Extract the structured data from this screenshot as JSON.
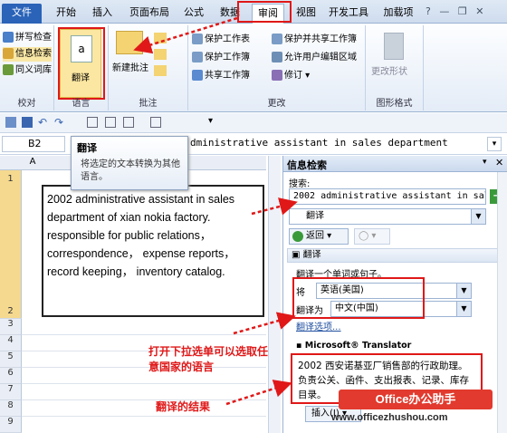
{
  "tabs": {
    "file": "文件",
    "items": [
      "开始",
      "插入",
      "页面布局",
      "公式",
      "数据",
      "审阅",
      "视图",
      "开发工具",
      "加载项"
    ]
  },
  "title_controls": {
    "help": "?",
    "minimize": "—",
    "restore": "❐",
    "close": "✕"
  },
  "ribbon": {
    "proof": {
      "label": "校对",
      "items": [
        "拼写检查",
        "信息检索",
        "同义词库"
      ]
    },
    "language": {
      "label": "语言",
      "translate": "翻译"
    },
    "comments": {
      "label": "批注",
      "new_comment": "新建批注"
    },
    "changes": {
      "label": "更改",
      "items": [
        "保护工作表",
        "保护工作簿",
        "共享工作簿"
      ],
      "items2": [
        "保护并共享工作簿",
        "允许用户编辑区域",
        "修订 ▾"
      ]
    },
    "ink": {
      "label": "图形格式",
      "item": "更改形状"
    }
  },
  "tooltip": {
    "title": "翻译",
    "body": "将选定的文本转换为其他语言。"
  },
  "formula_bar": {
    "cell_ref": "B2",
    "value": "dministrative assistant in sales department"
  },
  "grid": {
    "col_a": "A",
    "rows": [
      "1",
      "2",
      "3",
      "4",
      "5",
      "6",
      "7",
      "8",
      "9"
    ],
    "cell_text": "2002 administrative assistant in sales department of xian nokia factory. responsible for public relations， correspondence， expense reports， record keeping， inventory catalog."
  },
  "pane": {
    "title": "信息检索",
    "search_label": "搜索:",
    "search_value": "2002 administrative assistant in sales d",
    "service": "翻译",
    "back": "返回",
    "section": "翻译",
    "translate_hint": "翻译一个单词或句子。",
    "from_label": "将",
    "from_value": "英语(美国)",
    "to_label": "翻译为",
    "to_value": "中文(中国)",
    "options": "翻译选项...",
    "provider": "Microsoft® Translator",
    "result": "2002 西安诺基亚厂销售部的行政助理。负责公关、函件、支出报表、记录、库存目录。",
    "insert": "插入(I)"
  },
  "annotations": {
    "dropdown_note": "打开下拉选单可以选取任意国家的语言",
    "result_note": "翻译的结果"
  },
  "watermark": {
    "brand": "Office办公助手",
    "url": "www.officezhushou.com"
  },
  "colors": {
    "accent_red": "#e01818",
    "file_tab": "#2a63b8"
  }
}
